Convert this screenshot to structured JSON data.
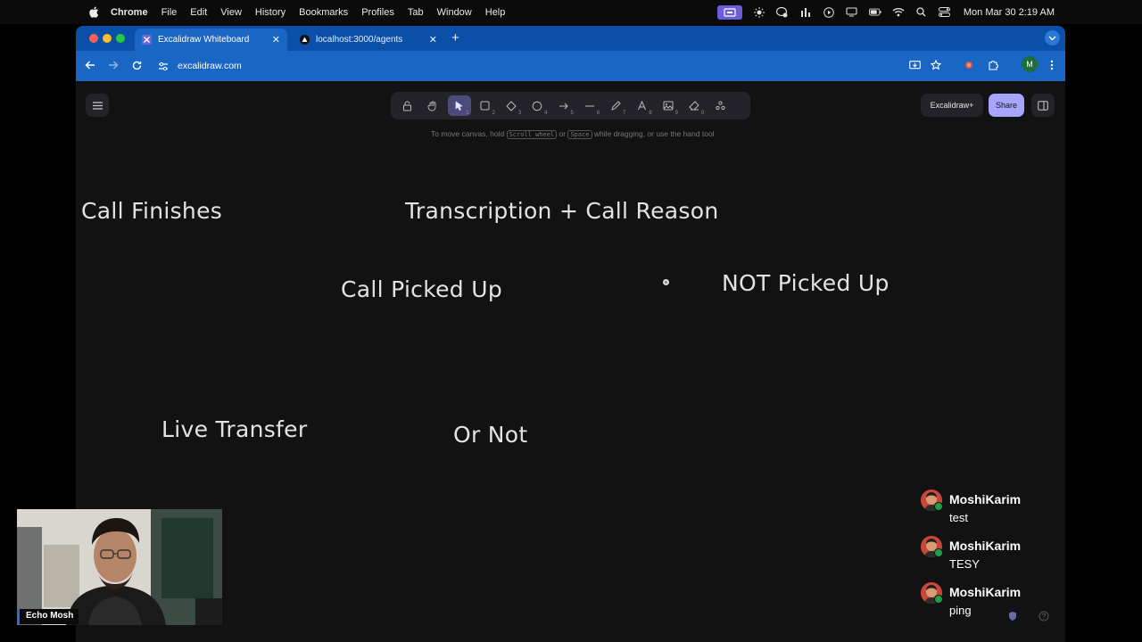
{
  "menubar": {
    "app_name": "Chrome",
    "items": [
      "File",
      "Edit",
      "View",
      "History",
      "Bookmarks",
      "Profiles",
      "Tab",
      "Window",
      "Help"
    ],
    "clock": "Mon Mar 30  2:19 AM"
  },
  "browser": {
    "tabs": [
      {
        "title": "Excalidraw Whiteboard",
        "active": true
      },
      {
        "title": "localhost:3000/agents",
        "active": false
      }
    ],
    "url": "excalidraw.com",
    "profile_initial": "M"
  },
  "excalidraw": {
    "toolbar_tools": [
      {
        "icon": "lock-icon",
        "key": ""
      },
      {
        "icon": "hand-icon",
        "key": ""
      },
      {
        "icon": "selection-icon",
        "key": "1"
      },
      {
        "icon": "rectangle-icon",
        "key": "2"
      },
      {
        "icon": "diamond-icon",
        "key": "3"
      },
      {
        "icon": "ellipse-icon",
        "key": "4"
      },
      {
        "icon": "arrow-icon",
        "key": "5"
      },
      {
        "icon": "line-icon",
        "key": "6"
      },
      {
        "icon": "pencil-icon",
        "key": "7"
      },
      {
        "icon": "text-icon",
        "key": "8"
      },
      {
        "icon": "image-icon",
        "key": "9"
      },
      {
        "icon": "eraser-icon",
        "key": "0"
      },
      {
        "icon": "more-tools-icon",
        "key": ""
      }
    ],
    "hint": {
      "part1": "To move canvas, hold ",
      "key1": "Scroll wheel",
      "part2": " or ",
      "key2": "Space",
      "part3": " while dragging, or use the hand tool"
    },
    "plus_label": "Excalidraw+",
    "share_label": "Share",
    "canvas_texts": {
      "call_finishes": "Call Finishes",
      "transcription": "Transcription + Call Reason",
      "call_picked_up": "Call Picked Up",
      "not_picked_up": "NOT Picked Up",
      "live_transfer": "Live Transfer",
      "or_not": "Or Not"
    }
  },
  "webcam": {
    "name": "Echo Mosh"
  },
  "chat": {
    "messages": [
      {
        "user": "MoshiKarim",
        "text": "test"
      },
      {
        "user": "MoshiKarim",
        "text": "TESY"
      },
      {
        "user": "MoshiKarim",
        "text": "ping"
      }
    ]
  },
  "colors": {
    "tabstrip": "#0a4fa8",
    "toolbar": "#1a66c4",
    "canvas_bg": "#121212",
    "accent": "#a8a5ff",
    "selected_tool": "#4c4a7a"
  }
}
